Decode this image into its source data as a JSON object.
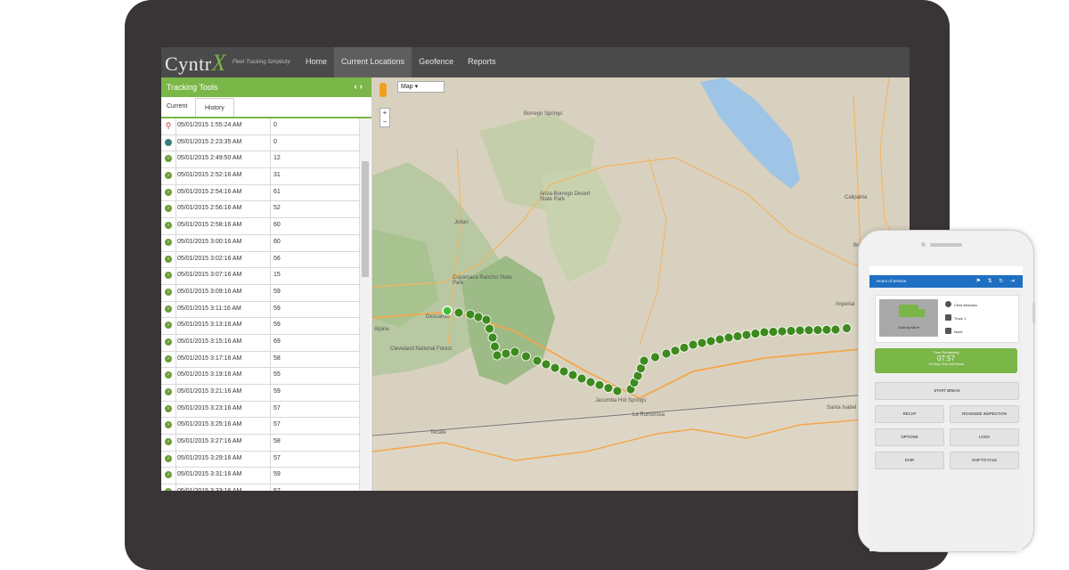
{
  "app": {
    "logo": "Cyntr",
    "logo_x": "X",
    "tagline": "Fleet Tracking Simplicity"
  },
  "nav": [
    {
      "label": "Home"
    },
    {
      "label": "Current Locations"
    },
    {
      "label": "Geofence"
    },
    {
      "label": "Reports"
    }
  ],
  "sidebar": {
    "title": "Tracking Tools",
    "arrows": "‹ ›",
    "tabs": {
      "current": "Current",
      "history": "History"
    },
    "rows": [
      {
        "date": "05/01/2015 1:55:24 AM",
        "speed": "0",
        "icon": "pin"
      },
      {
        "date": "05/01/2015 2:23:35 AM",
        "speed": "0",
        "icon": "teal"
      },
      {
        "date": "05/01/2015 2:49:50 AM",
        "speed": "12",
        "icon": "arrow"
      },
      {
        "date": "05/01/2015 2:52:16 AM",
        "speed": "31",
        "icon": "arrow"
      },
      {
        "date": "05/01/2015 2:54:16 AM",
        "speed": "61",
        "icon": "arrow"
      },
      {
        "date": "05/01/2015 2:56:16 AM",
        "speed": "52",
        "icon": "arrow"
      },
      {
        "date": "05/01/2015 2:58:16 AM",
        "speed": "60",
        "icon": "arrow"
      },
      {
        "date": "05/01/2015 3:00:16 AM",
        "speed": "60",
        "icon": "arrow"
      },
      {
        "date": "05/01/2015 3:02:16 AM",
        "speed": "56",
        "icon": "arrow"
      },
      {
        "date": "05/01/2015 3:07:16 AM",
        "speed": "15",
        "icon": "arrow"
      },
      {
        "date": "05/01/2015 3:09:16 AM",
        "speed": "59",
        "icon": "arrow"
      },
      {
        "date": "05/01/2015 3:11:16 AM",
        "speed": "59",
        "icon": "arrow"
      },
      {
        "date": "05/01/2015 3:13:16 AM",
        "speed": "59",
        "icon": "arrow"
      },
      {
        "date": "05/01/2015 3:15:16 AM",
        "speed": "69",
        "icon": "arrow"
      },
      {
        "date": "05/01/2015 3:17:16 AM",
        "speed": "58",
        "icon": "arrow"
      },
      {
        "date": "05/01/2015 3:19:16 AM",
        "speed": "55",
        "icon": "arrow"
      },
      {
        "date": "05/01/2015 3:21:16 AM",
        "speed": "59",
        "icon": "arrow"
      },
      {
        "date": "05/01/2015 3:23:16 AM",
        "speed": "57",
        "icon": "arrow"
      },
      {
        "date": "05/01/2015 3:25:16 AM",
        "speed": "57",
        "icon": "arrow"
      },
      {
        "date": "05/01/2015 3:27:16 AM",
        "speed": "58",
        "icon": "arrow"
      },
      {
        "date": "05/01/2015 3:29:16 AM",
        "speed": "57",
        "icon": "arrow"
      },
      {
        "date": "05/01/2015 3:31:16 AM",
        "speed": "59",
        "icon": "arrow"
      },
      {
        "date": "05/01/2015 3:33:16 AM",
        "speed": "57",
        "icon": "arrow"
      }
    ]
  },
  "map": {
    "type_select": "Map",
    "zoom_in": "+",
    "zoom_out": "−",
    "labels": [
      "Borrego Springs",
      "Anza-Borrego Desert State Park",
      "Julian",
      "Cuyamaca Rancho State Park",
      "Descanso",
      "Alpine",
      "Cleveland National Forest",
      "Jacumba Hot Springs",
      "La Rumorosa",
      "Tecate",
      "Calipatria",
      "Imperial",
      "Santa Isabel",
      "Brawley"
    ],
    "route_color": "#3d8a1e"
  },
  "phone": {
    "title": "Hours of Service",
    "driver": "Chris Mouniau",
    "truck": "Truck 1",
    "trailer": "None",
    "status": "OnDuty ND",
    "time_label": "Time Remaining",
    "time_value": "07:57",
    "time_sub": "On Duty Time Until Break",
    "buttons": {
      "start_break": "START BREAK",
      "recap": "RECAP",
      "roadside": "ROADSIDE INSPECTION",
      "options": "OPTIONS",
      "logs": "LOGS",
      "dvir": "DVIR",
      "shift": "SHIFT/CYCLE"
    }
  }
}
